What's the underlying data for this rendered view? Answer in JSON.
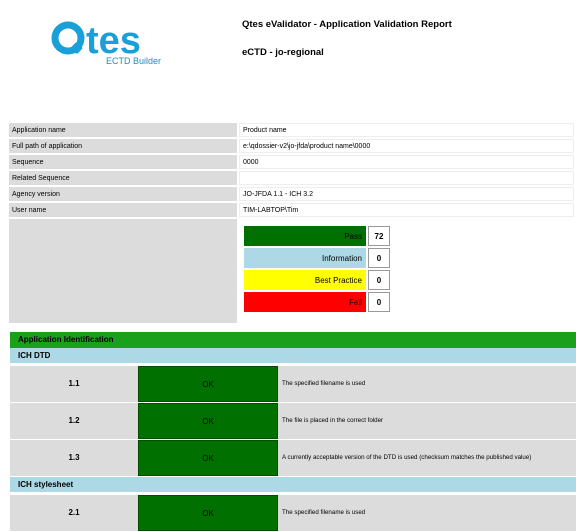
{
  "logo": {
    "text": "Qtes",
    "subtitle": "ECTD Builder",
    "color": "#1aa0d8"
  },
  "header": {
    "title": "Qtes eValidator - Application Validation Report",
    "subtitle": "eCTD - jo-regional"
  },
  "info": [
    {
      "key": "Application name",
      "value": "Product name"
    },
    {
      "key": "Full path of application",
      "value": "e:\\qdossier-v2\\jo-jfda\\product name\\0000"
    },
    {
      "key": "Sequence",
      "value": "0000"
    },
    {
      "key": "Related Sequence",
      "value": ""
    },
    {
      "key": "Agency version",
      "value": "JO-JFDA 1.1 - ICH 3.2"
    },
    {
      "key": "User name",
      "value": "TIM-LABTOP\\Tim"
    }
  ],
  "summary": [
    {
      "label": "Pass",
      "count": "72",
      "color": "#007000"
    },
    {
      "label": "Information",
      "count": "0",
      "color": "#add8e6"
    },
    {
      "label": "Best Practice",
      "count": "0",
      "color": "#ffff00"
    },
    {
      "label": "Fail",
      "count": "0",
      "color": "#ff0000"
    }
  ],
  "sections": {
    "app_identification": "Application Identification",
    "ich_dtd": "ICH DTD",
    "ich_stylesheet": "ICH stylesheet"
  },
  "checks": [
    {
      "id": "1.1",
      "result": "OK",
      "description": "The specified filename is used"
    },
    {
      "id": "1.2",
      "result": "OK",
      "description": "The file is placed in the correct folder"
    },
    {
      "id": "1.3",
      "result": "OK",
      "description": "A currently acceptable version of the DTD is used (checksum matches the published value)"
    },
    {
      "id": "2.1",
      "result": "OK",
      "description": "The specified filename is used"
    }
  ]
}
